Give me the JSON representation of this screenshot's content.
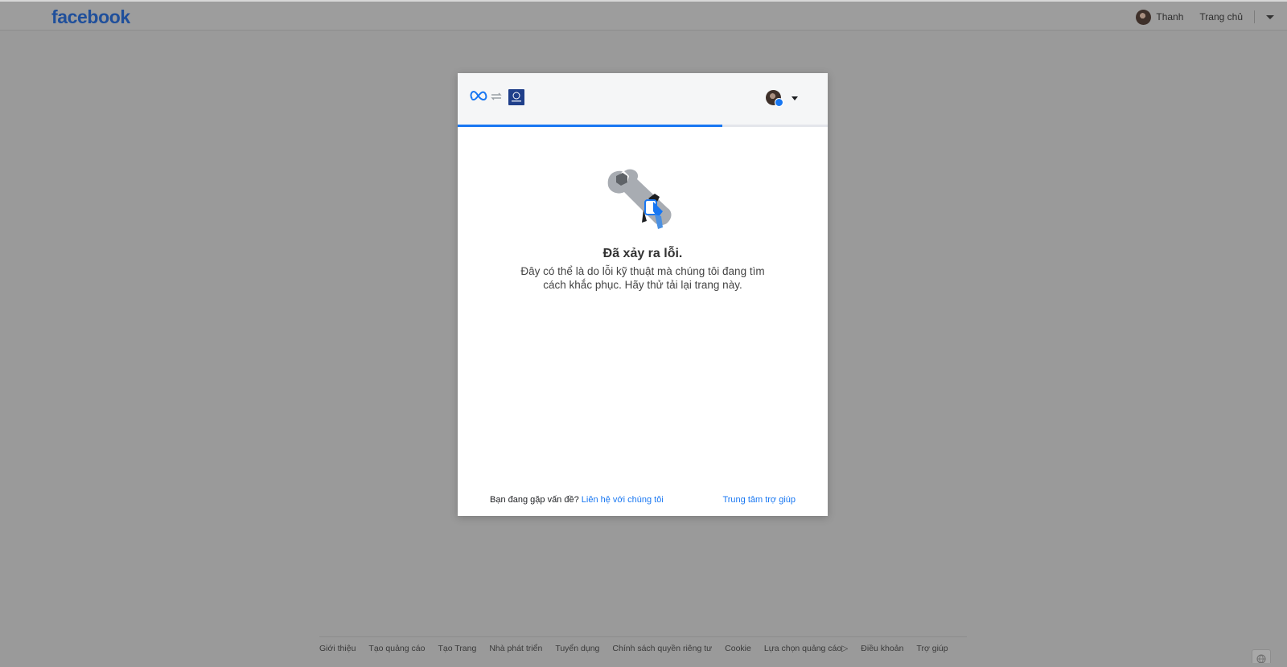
{
  "topbar": {
    "logo": "facebook",
    "user_name": "Thanh",
    "home_label": "Trang chủ"
  },
  "dialog": {
    "progress_fraction": 0.715,
    "error": {
      "title": "Đã xảy ra lỗi.",
      "message": "Đây có thể là do lỗi kỹ thuật mà chúng tôi đang tìm cách khắc phục. Hãy thử tải lại trang này."
    },
    "footer": {
      "question": "Bạn đang gặp vấn đề?",
      "contact_link": "Liên hệ với chúng tôi",
      "help_center_link": "Trung tâm trợ giúp"
    }
  },
  "footer": {
    "links": [
      "Giới thiệu",
      "Tạo quảng cáo",
      "Tạo Trang",
      "Nhà phát triển",
      "Tuyển dụng",
      "Chính sách quyền riêng tư",
      "Cookie",
      "Lựa chọn quảng cáo",
      "Điều khoản",
      "Trợ giúp"
    ]
  },
  "colors": {
    "brand_blue": "#1877f2",
    "overlay_gray": "#9a9a9a"
  },
  "icons": {
    "meta_logo": "meta-infinity-icon",
    "sync": "sync-arrows-icon",
    "app": "app-icon",
    "help_illustration": "wrench-robot-icon",
    "adchoices": "adchoices-icon",
    "globe": "globe-icon"
  }
}
